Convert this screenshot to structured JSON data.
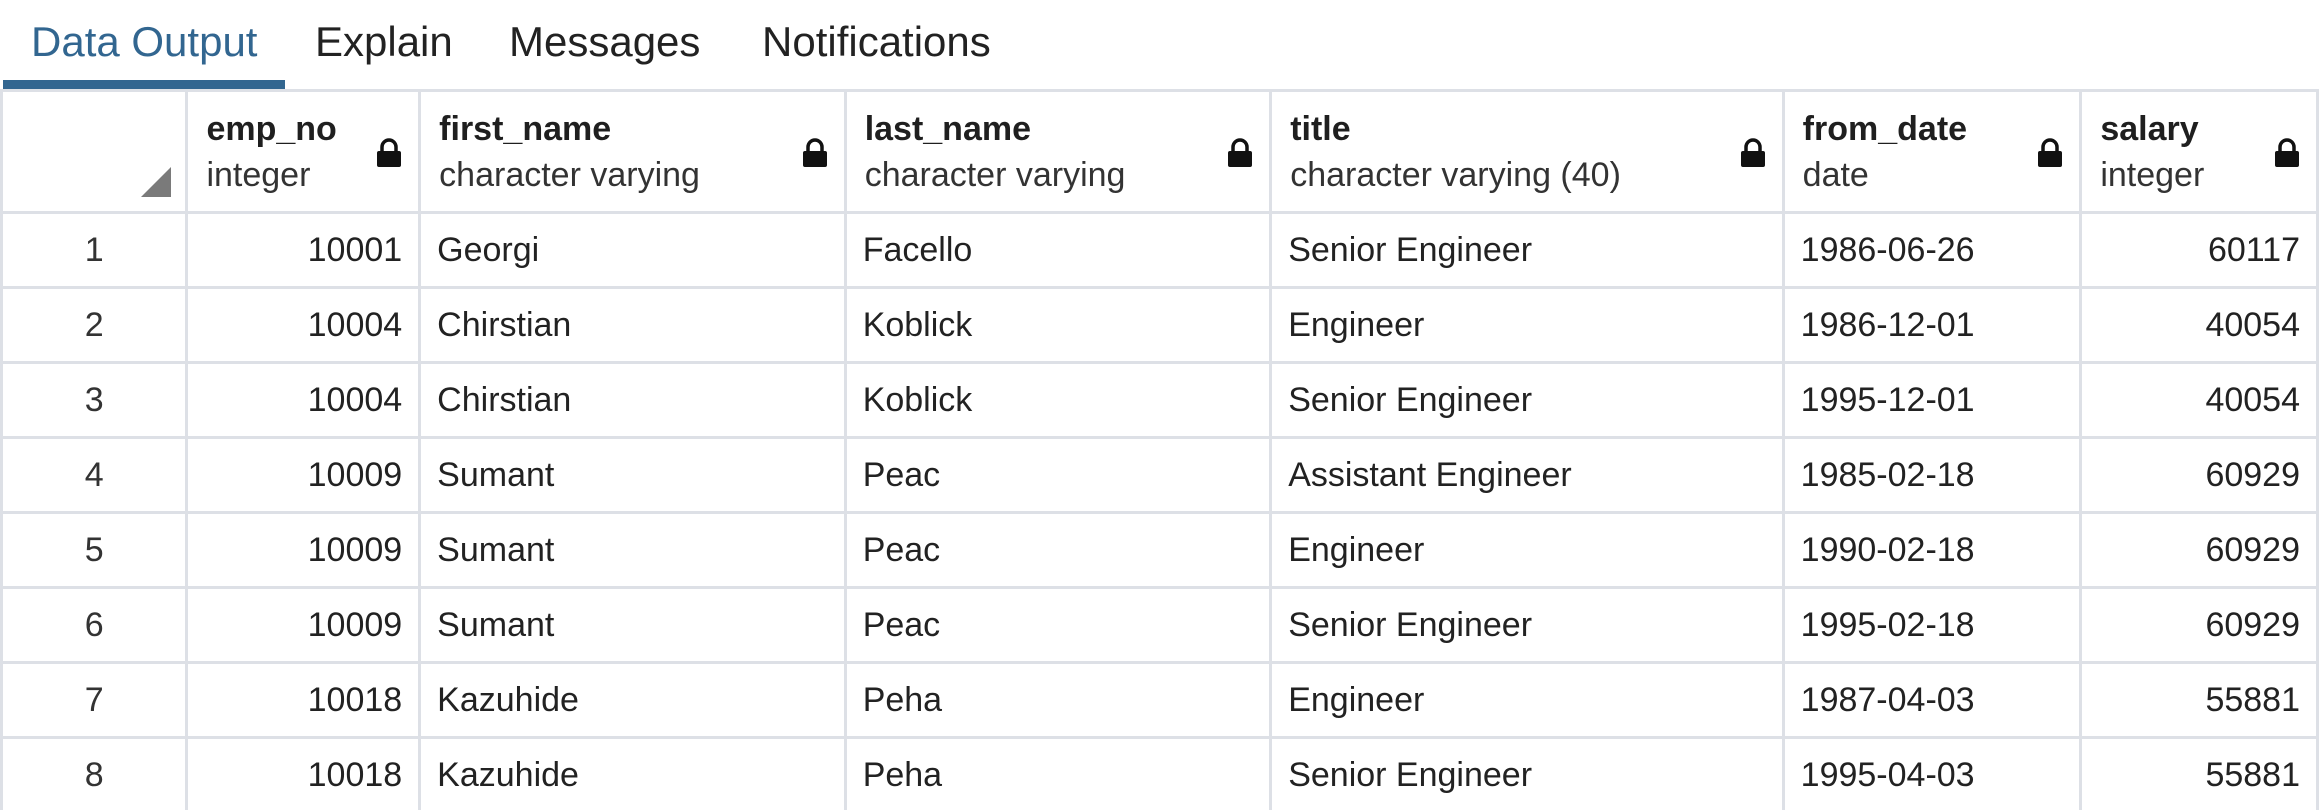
{
  "tabs": [
    {
      "label": "Data Output",
      "active": true
    },
    {
      "label": "Explain",
      "active": false
    },
    {
      "label": "Messages",
      "active": false
    },
    {
      "label": "Notifications",
      "active": false
    }
  ],
  "colors": {
    "accent": "#326690",
    "grid_border": "#dde0e6"
  },
  "columns": [
    {
      "name": "emp_no",
      "type": "integer",
      "icon": "lock-icon"
    },
    {
      "name": "first_name",
      "type": "character varying",
      "icon": "lock-icon"
    },
    {
      "name": "last_name",
      "type": "character varying",
      "icon": "lock-icon"
    },
    {
      "name": "title",
      "type": "character varying (40)",
      "icon": "lock-icon"
    },
    {
      "name": "from_date",
      "type": "date",
      "icon": "lock-icon"
    },
    {
      "name": "salary",
      "type": "integer",
      "icon": "lock-icon"
    }
  ],
  "rows": [
    {
      "n": "1",
      "emp_no": "10001",
      "first_name": "Georgi",
      "last_name": "Facello",
      "title": "Senior Engineer",
      "from_date": "1986-06-26",
      "salary": "60117"
    },
    {
      "n": "2",
      "emp_no": "10004",
      "first_name": "Chirstian",
      "last_name": "Koblick",
      "title": "Engineer",
      "from_date": "1986-12-01",
      "salary": "40054"
    },
    {
      "n": "3",
      "emp_no": "10004",
      "first_name": "Chirstian",
      "last_name": "Koblick",
      "title": "Senior Engineer",
      "from_date": "1995-12-01",
      "salary": "40054"
    },
    {
      "n": "4",
      "emp_no": "10009",
      "first_name": "Sumant",
      "last_name": "Peac",
      "title": "Assistant Engineer",
      "from_date": "1985-02-18",
      "salary": "60929"
    },
    {
      "n": "5",
      "emp_no": "10009",
      "first_name": "Sumant",
      "last_name": "Peac",
      "title": "Engineer",
      "from_date": "1990-02-18",
      "salary": "60929"
    },
    {
      "n": "6",
      "emp_no": "10009",
      "first_name": "Sumant",
      "last_name": "Peac",
      "title": "Senior Engineer",
      "from_date": "1995-02-18",
      "salary": "60929"
    },
    {
      "n": "7",
      "emp_no": "10018",
      "first_name": "Kazuhide",
      "last_name": "Peha",
      "title": "Engineer",
      "from_date": "1987-04-03",
      "salary": "55881"
    },
    {
      "n": "8",
      "emp_no": "10018",
      "first_name": "Kazuhide",
      "last_name": "Peha",
      "title": "Senior Engineer",
      "from_date": "1995-04-03",
      "salary": "55881"
    }
  ]
}
